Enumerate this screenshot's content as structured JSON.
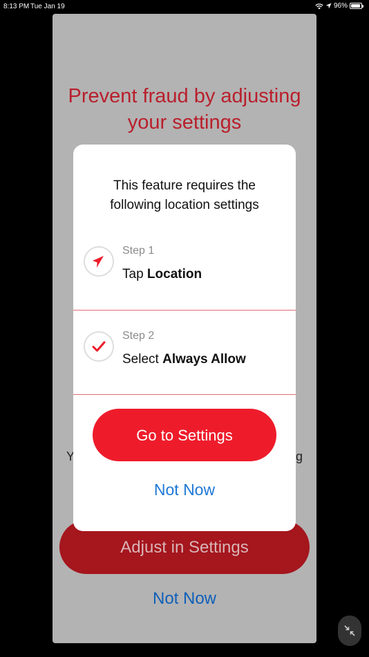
{
  "status_bar": {
    "time": "8:13 PM",
    "date": "Tue Jan 19",
    "battery": "96%"
  },
  "background_sheet": {
    "title": "Prevent fraud by adjusting your settings",
    "partial_text_left": "Y",
    "partial_text_right": "g",
    "adjust_button_label": "Adjust in Settings",
    "not_now_label": "Not Now"
  },
  "modal": {
    "title": "This feature requires the following location settings",
    "steps": [
      {
        "label": "Step 1",
        "prefix": "Tap ",
        "emphasis": "Location",
        "icon": "location-arrow-icon"
      },
      {
        "label": "Step 2",
        "prefix": "Select ",
        "emphasis": "Always Allow",
        "icon": "checkmark-icon"
      }
    ],
    "primary_button_label": "Go to Settings",
    "secondary_button_label": "Not Now"
  },
  "colors": {
    "brand_red": "#ee1c2b",
    "dark_red": "#a5161d",
    "link_blue": "#1f78d6",
    "title_red": "#b91f2c"
  }
}
